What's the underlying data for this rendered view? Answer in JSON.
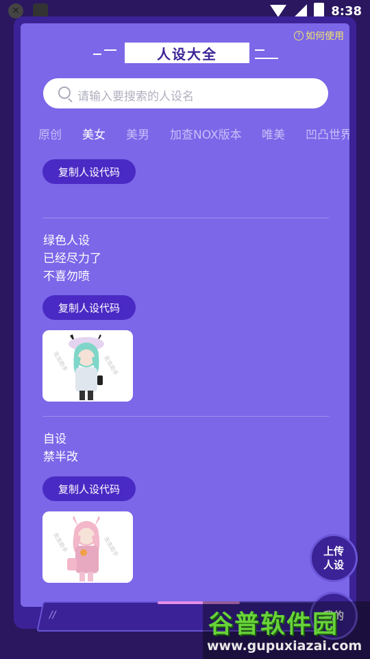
{
  "status_bar": {
    "time": "8:38"
  },
  "header": {
    "title": "人设大全",
    "help_link": "如何使用"
  },
  "search": {
    "placeholder": "请输入要搜索的人设名"
  },
  "tabs": [
    {
      "label": "原创"
    },
    {
      "label": "美女"
    },
    {
      "label": "美男"
    },
    {
      "label": "加查NOX版本"
    },
    {
      "label": "唯美"
    },
    {
      "label": "凹凸世界"
    }
  ],
  "active_tab": "美女",
  "posts": [
    {
      "lines": [],
      "copy_label": "复制人设代码"
    },
    {
      "lines": [
        "绿色人设",
        "已经尽力了",
        "不喜勿喷"
      ],
      "copy_label": "复制人设代码"
    },
    {
      "lines": [
        "自设",
        "禁半改"
      ],
      "copy_label": "复制人设代码"
    }
  ],
  "fab": {
    "upload_line1": "上传",
    "upload_line2": "人设",
    "mine_label": "我的"
  },
  "watermark": {
    "brand": "谷普软件园",
    "url": "www.gupuxiazai.com"
  },
  "colors": {
    "panel": "#7b67e8",
    "frame": "#3b2296",
    "button": "#4a2ac4",
    "help": "#f2e66a"
  }
}
